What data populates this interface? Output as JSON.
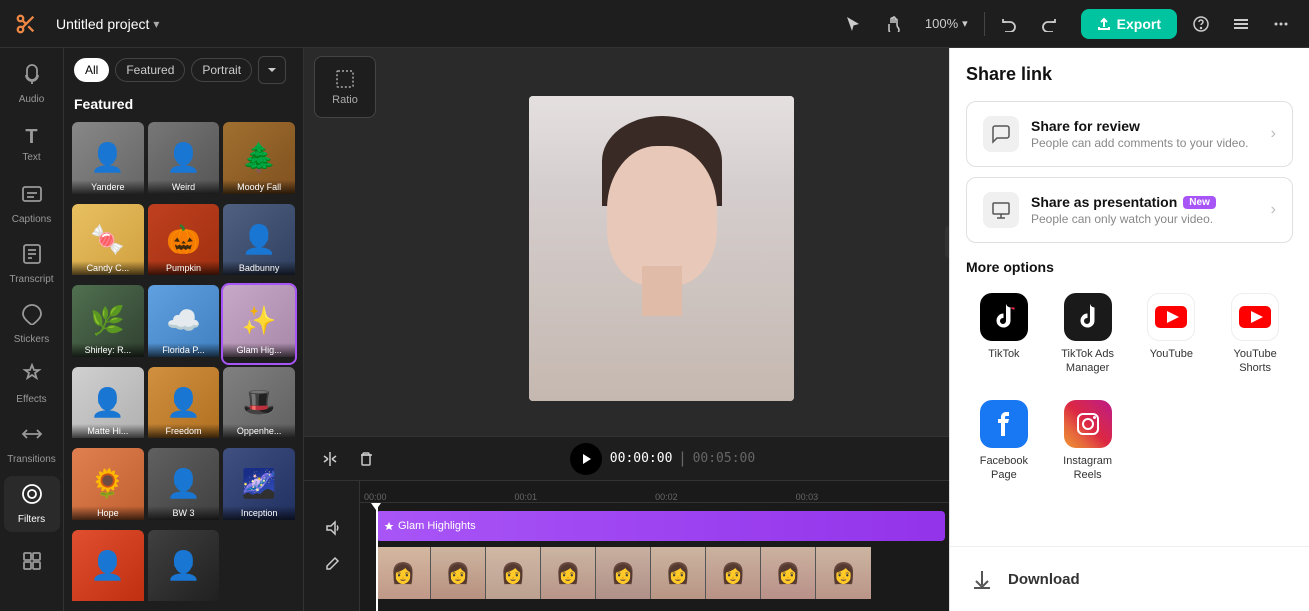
{
  "topbar": {
    "logo": "✂",
    "project_name": "Untitled project",
    "zoom": "100%",
    "export_label": "Export",
    "undo_icon": "↩",
    "redo_icon": "↪"
  },
  "tools": [
    {
      "id": "audio",
      "icon": "♪",
      "label": "Audio"
    },
    {
      "id": "text",
      "icon": "T",
      "label": "Text"
    },
    {
      "id": "captions",
      "icon": "≡",
      "label": "Captions"
    },
    {
      "id": "transcript",
      "icon": "📝",
      "label": "Transcript"
    },
    {
      "id": "stickers",
      "icon": "⭐",
      "label": "Stickers"
    },
    {
      "id": "effects",
      "icon": "✨",
      "label": "Effects"
    },
    {
      "id": "transitions",
      "icon": "⇄",
      "label": "Transitions"
    },
    {
      "id": "filters",
      "icon": "◉",
      "label": "Filters",
      "active": true
    }
  ],
  "media_panel": {
    "filters": [
      "All",
      "Featured",
      "Portrait"
    ],
    "title": "Featured",
    "items": [
      {
        "label": "Yandere",
        "bg": "#888"
      },
      {
        "label": "Weird",
        "bg": "#777"
      },
      {
        "label": "Moody Fall",
        "bg": "#a07030"
      },
      {
        "label": "Candy C...",
        "bg": "#e8c060"
      },
      {
        "label": "Pumpkin",
        "bg": "#c04020"
      },
      {
        "label": "Badbunny",
        "bg": "#506080"
      },
      {
        "label": "Shirley: R...",
        "bg": "#507050"
      },
      {
        "label": "Florida P...",
        "bg": "#60a0e0"
      },
      {
        "label": "Glam Hig...",
        "bg": "#c8a8c8"
      },
      {
        "label": "Matte Hi...",
        "bg": "#d0d0d0"
      },
      {
        "label": "Freedom",
        "bg": "#d09040"
      },
      {
        "label": "Oppenhe...",
        "bg": "#808080"
      },
      {
        "label": "Hope",
        "bg": "#e08050"
      },
      {
        "label": "BW 3",
        "bg": "#606060"
      },
      {
        "label": "Inception",
        "bg": "#405080"
      }
    ]
  },
  "canvas": {
    "ratio_label": "Ratio"
  },
  "timeline": {
    "current_time": "00:00:00",
    "total_time": "00:05:00",
    "clip_label": "Glam Highlights",
    "ticks": [
      "00:00",
      "00:01",
      "00:02",
      "00:03"
    ]
  },
  "right_panel": {
    "share_title": "Share link",
    "share_for_review_title": "Share for review",
    "share_for_review_subtitle": "People can add comments to your video.",
    "share_as_presentation_title": "Share as presentation",
    "share_as_presentation_badge": "New",
    "share_as_presentation_subtitle": "People can only watch your video.",
    "more_options_title": "More options",
    "platforms": [
      {
        "id": "tiktok",
        "label": "TikTok",
        "icon_type": "tiktok"
      },
      {
        "id": "tiktok-ads",
        "label": "TikTok Ads Manager",
        "icon_type": "tiktok-biz"
      },
      {
        "id": "youtube",
        "label": "YouTube",
        "icon_type": "youtube"
      },
      {
        "id": "youtube-shorts",
        "label": "YouTube Shorts",
        "icon_type": "youtube-shorts"
      },
      {
        "id": "facebook",
        "label": "Facebook Page",
        "icon_type": "facebook"
      },
      {
        "id": "instagram",
        "label": "Instagram Reels",
        "icon_type": "instagram"
      }
    ],
    "download_label": "Download"
  }
}
